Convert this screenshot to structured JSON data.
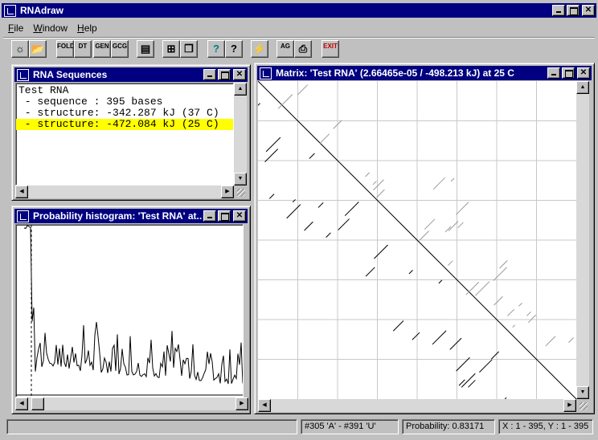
{
  "app": {
    "title": "RNAdraw"
  },
  "menu": [
    {
      "label": "File",
      "accel": "F",
      "rest": "ile"
    },
    {
      "label": "Window",
      "accel": "W",
      "rest": "indow"
    },
    {
      "label": "Help",
      "accel": "H",
      "rest": "elp"
    }
  ],
  "toolbar": [
    {
      "name": "settings-button",
      "icon": "gear-icon",
      "glyph": "☼",
      "label": ""
    },
    {
      "name": "open-button",
      "icon": "folder-open-icon",
      "glyph": "📂",
      "label": ""
    },
    {
      "name": "fold-button",
      "icon": "fold-icon",
      "glyph": "",
      "label": "FOLD"
    },
    {
      "name": "dot-button",
      "icon": "dot-plot-icon",
      "glyph": "",
      "label": "DT"
    },
    {
      "name": "gen-button",
      "icon": "gen-icon",
      "glyph": "",
      "label": "GEN"
    },
    {
      "name": "gcg-button",
      "icon": "gcg-icon",
      "glyph": "",
      "label": "GCG"
    },
    {
      "name": "text-view-button",
      "icon": "text-window-icon",
      "glyph": "▤",
      "label": ""
    },
    {
      "name": "tile-button",
      "icon": "tile-windows-icon",
      "glyph": "⊞",
      "label": ""
    },
    {
      "name": "cascade-button",
      "icon": "cascade-windows-icon",
      "glyph": "❐",
      "label": ""
    },
    {
      "name": "help-button",
      "icon": "question-mark-icon",
      "glyph": "?",
      "label": ""
    },
    {
      "name": "context-help-button",
      "icon": "help-box-icon",
      "glyph": "?",
      "label": ""
    },
    {
      "name": "compute-button",
      "icon": "lightning-icon",
      "glyph": "⚡",
      "label": ""
    },
    {
      "name": "alignment-button",
      "icon": "alignment-icon",
      "glyph": "",
      "label": "AG"
    },
    {
      "name": "print-button",
      "icon": "printer-icon",
      "glyph": "⎙",
      "label": ""
    },
    {
      "name": "exit-button",
      "icon": "exit-door-icon",
      "glyph": "",
      "label": "EXIT"
    }
  ],
  "sequences_window": {
    "title": "RNA Sequences",
    "lines": [
      "Test RNA",
      " - sequence : 395 bases",
      " - structure: -342.287 kJ (37 C)",
      " - structure: -472.084 kJ (25 C)"
    ],
    "selected_index": 3,
    "highlight_color": "#ffff00"
  },
  "histogram_window": {
    "title": "Probability histogram: 'Test RNA' at..."
  },
  "matrix_window": {
    "title": "Matrix: 'Test RNA'  (2.66465e-05 / -498.213 kJ) at 25 C",
    "grid_divisions": 8
  },
  "status": {
    "pair": "#305 'A' - #391 'U'",
    "probability": "Probability: 0.83171",
    "range": "X : 1 - 395, Y : 1 - 395"
  },
  "colors": {
    "title_active": "#000080",
    "face": "#c0c0c0"
  }
}
